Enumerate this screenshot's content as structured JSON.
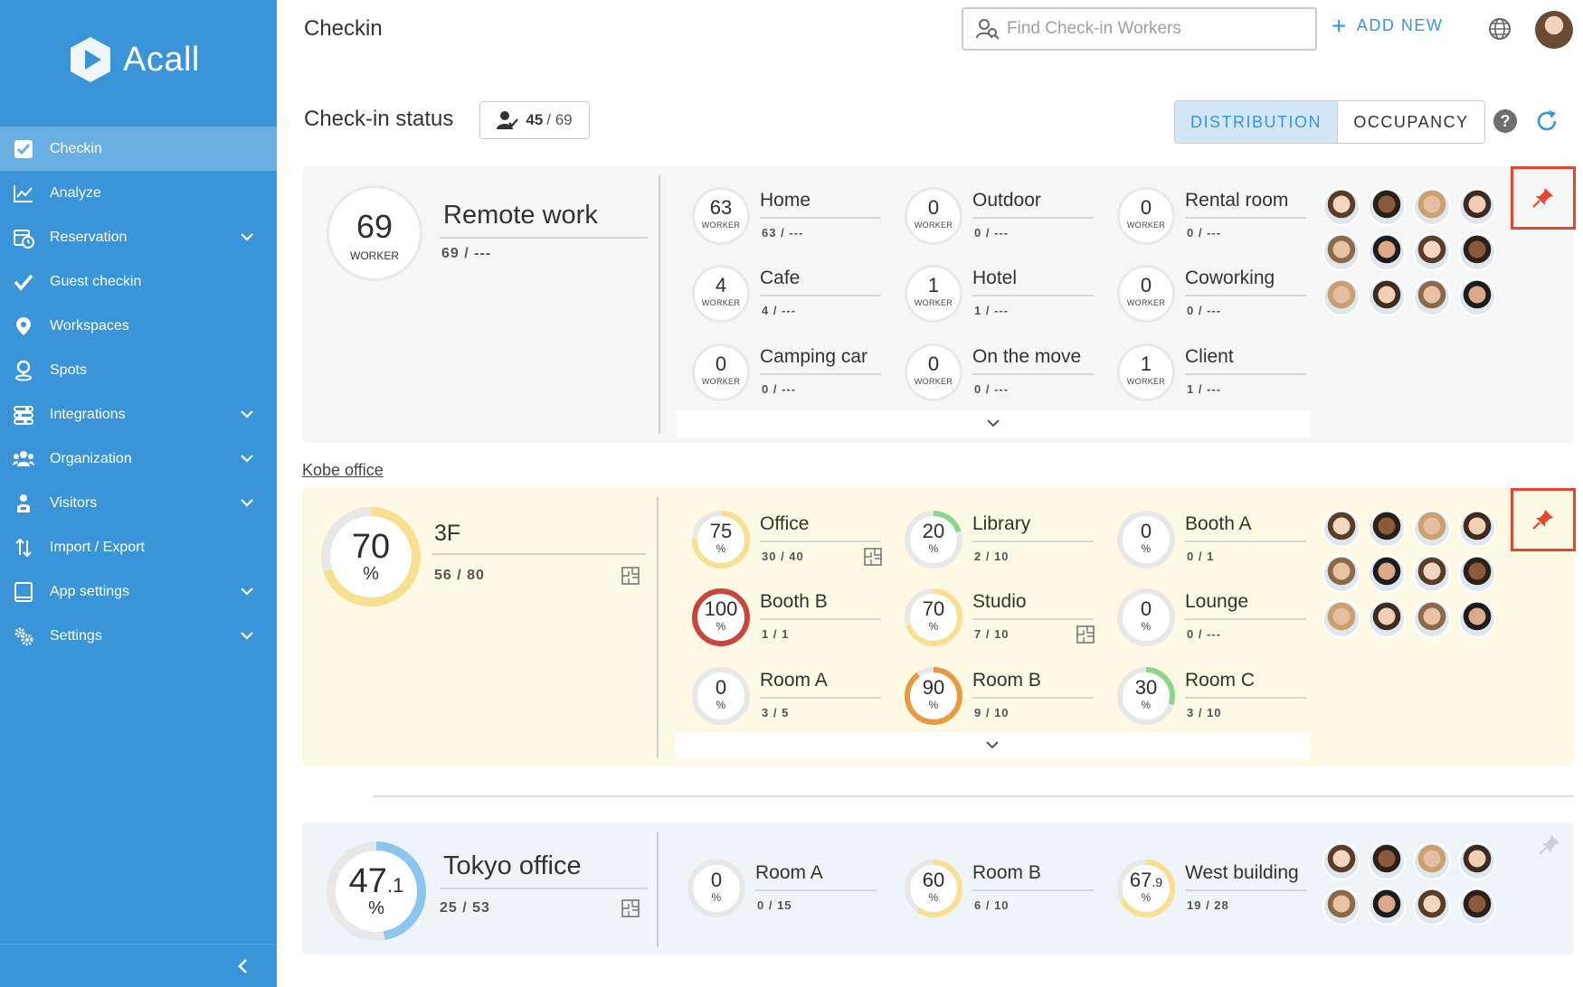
{
  "app": {
    "name": "Acall"
  },
  "sidebar": {
    "items": [
      {
        "label": "Checkin",
        "icon": "checkbox-icon",
        "active": true,
        "expandable": false
      },
      {
        "label": "Analyze",
        "icon": "chart-icon",
        "active": false,
        "expandable": false
      },
      {
        "label": "Reservation",
        "icon": "calendar-clock-icon",
        "active": false,
        "expandable": true
      },
      {
        "label": "Guest checkin",
        "icon": "check-icon",
        "active": false,
        "expandable": false
      },
      {
        "label": "Workspaces",
        "icon": "map-pin-icon",
        "active": false,
        "expandable": false
      },
      {
        "label": "Spots",
        "icon": "location-icon",
        "active": false,
        "expandable": false
      },
      {
        "label": "Integrations",
        "icon": "sliders-icon",
        "active": false,
        "expandable": true
      },
      {
        "label": "Organization",
        "icon": "users-icon",
        "active": false,
        "expandable": true
      },
      {
        "label": "Visitors",
        "icon": "visitor-icon",
        "active": false,
        "expandable": true
      },
      {
        "label": "Import / Export",
        "icon": "import-export-icon",
        "active": false,
        "expandable": false
      },
      {
        "label": "App settings",
        "icon": "tablet-icon",
        "active": false,
        "expandable": true
      },
      {
        "label": "Settings",
        "icon": "gears-icon",
        "active": false,
        "expandable": true
      }
    ]
  },
  "header": {
    "title": "Checkin",
    "search_placeholder": "Find Check-in Workers",
    "add_new_label": "ADD NEW"
  },
  "status": {
    "title": "Check-in status",
    "checked_in": "45",
    "total": "/ 69",
    "tabs": [
      "DISTRIBUTION",
      "OCCUPANCY"
    ],
    "active_tab": "DISTRIBUTION"
  },
  "remote_work": {
    "big_number": "69",
    "big_unit": "WORKER",
    "name": "Remote work",
    "sub": "69 / ---",
    "items": [
      {
        "value": "63",
        "unit": "WORKER",
        "name": "Home",
        "sub": "63 / ---"
      },
      {
        "value": "0",
        "unit": "WORKER",
        "name": "Outdoor",
        "sub": "0 / ---"
      },
      {
        "value": "0",
        "unit": "WORKER",
        "name": "Rental room",
        "sub": "0 / ---"
      },
      {
        "value": "4",
        "unit": "WORKER",
        "name": "Cafe",
        "sub": "4 / ---"
      },
      {
        "value": "1",
        "unit": "WORKER",
        "name": "Hotel",
        "sub": "1 / ---"
      },
      {
        "value": "0",
        "unit": "WORKER",
        "name": "Coworking",
        "sub": "0 / ---"
      },
      {
        "value": "0",
        "unit": "WORKER",
        "name": "Camping car",
        "sub": "0 / ---"
      },
      {
        "value": "0",
        "unit": "WORKER",
        "name": "On the move",
        "sub": "0 / ---"
      },
      {
        "value": "1",
        "unit": "WORKER",
        "name": "Client",
        "sub": "1 / ---"
      }
    ]
  },
  "kobe": {
    "office_label": "Kobe office",
    "big_number": "70",
    "big_unit": "%",
    "occupancy_percent": 70,
    "name": "3F",
    "sub": "56 / 80",
    "items": [
      {
        "value": "75",
        "percent": 75,
        "name": "Office",
        "sub": "30 / 40",
        "floorplan": true
      },
      {
        "value": "20",
        "percent": 20,
        "name": "Library",
        "sub": "2 / 10",
        "floorplan": false
      },
      {
        "value": "0",
        "percent": 0,
        "name": "Booth A",
        "sub": "0 / 1",
        "floorplan": false
      },
      {
        "value": "100",
        "percent": 100,
        "name": "Booth B",
        "sub": "1 / 1",
        "floorplan": false
      },
      {
        "value": "70",
        "percent": 70,
        "name": "Studio",
        "sub": "7 / 10",
        "floorplan": true
      },
      {
        "value": "0",
        "percent": 0,
        "name": "Lounge",
        "sub": "0 / ---",
        "floorplan": false
      },
      {
        "value": "0",
        "percent": 0,
        "name": "Room A",
        "sub": "3 / 5",
        "floorplan": false
      },
      {
        "value": "90",
        "percent": 90,
        "name": "Room B",
        "sub": "9 / 10",
        "floorplan": false
      },
      {
        "value": "30",
        "percent": 30,
        "name": "Room C",
        "sub": "3 / 10",
        "floorplan": false
      }
    ]
  },
  "tokyo": {
    "big_number": "47",
    "big_decimal": ".1",
    "big_unit": "%",
    "occupancy_percent": 47.1,
    "name": "Tokyo office",
    "sub": "25 / 53",
    "items": [
      {
        "value": "0",
        "decimal": "",
        "percent": 0,
        "name": "Room A",
        "sub": "0 / 15"
      },
      {
        "value": "60",
        "decimal": "",
        "percent": 60,
        "name": "Room B",
        "sub": "6 / 10"
      },
      {
        "value": "67",
        "decimal": ".9",
        "percent": 67.9,
        "name": "West building",
        "sub": "19 / 28"
      }
    ]
  },
  "colors": {
    "sidebar": "#3a95d8",
    "accent": "#3a95d8",
    "ring_track": "#e8e8e8",
    "ring_yellow": "#f7e08f",
    "ring_green": "#8fd48c",
    "ring_orange": "#e79a3f",
    "ring_red": "#c9463f",
    "ring_blue": "#8cc6ef",
    "pin": "#e8452f"
  }
}
